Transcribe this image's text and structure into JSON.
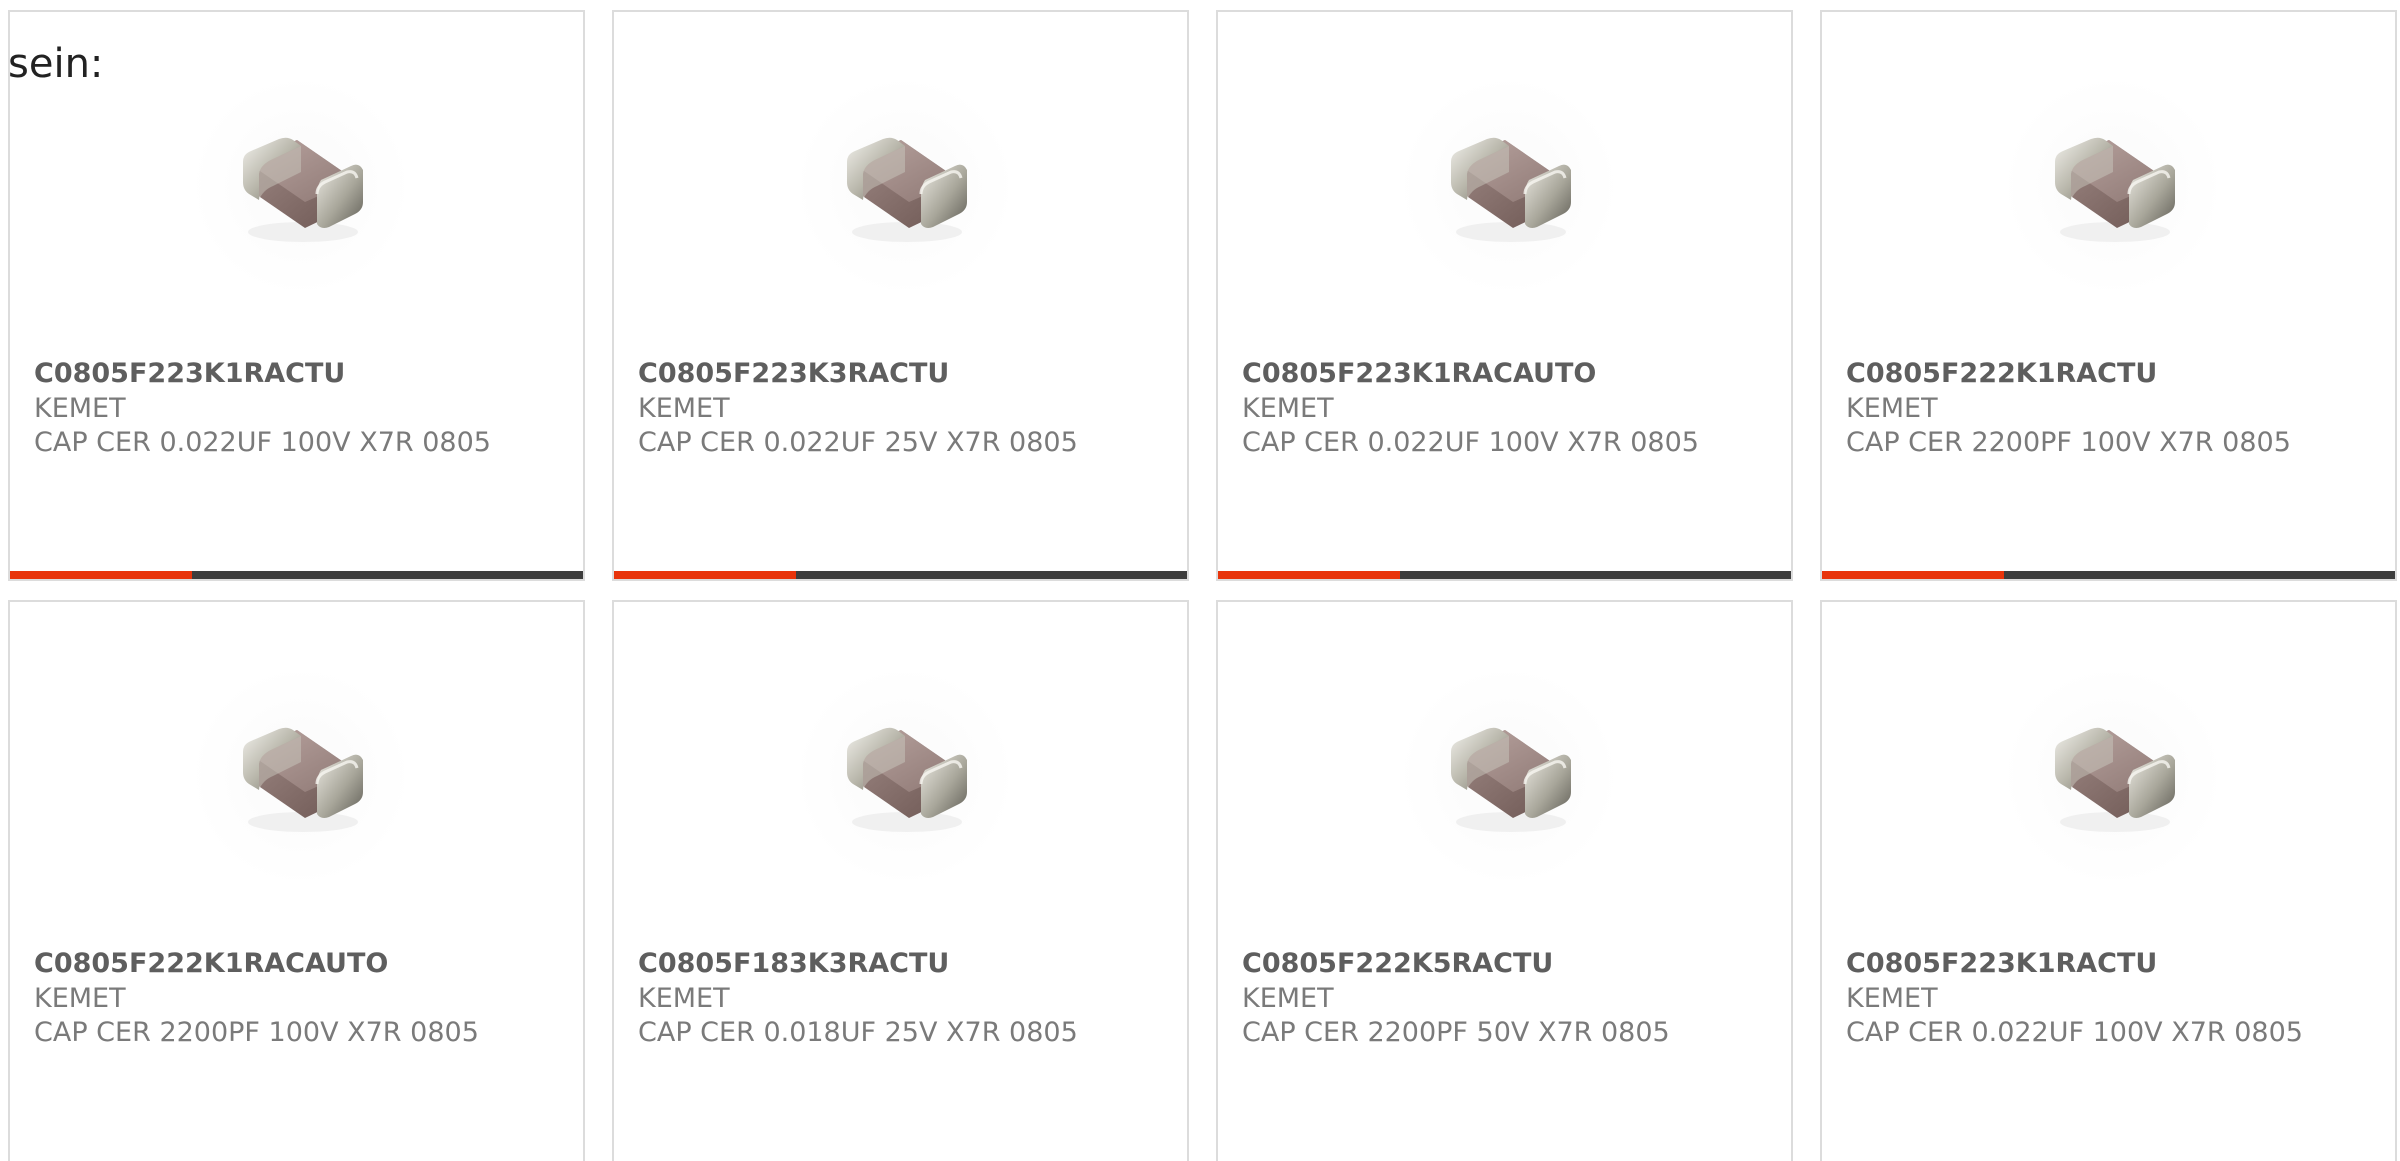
{
  "intro_text": "sein:",
  "colors": {
    "accent_bar": "#e8340b",
    "dark_bar": "#3d3d3d",
    "card_border": "#dcdcdc"
  },
  "products": [
    {
      "part_number": "C0805F223K1RACTU",
      "manufacturer": "KEMET",
      "description": "CAP CER 0.022UF 100V X7R 0805",
      "image_icon": "ceramic-capacitor-chip-icon"
    },
    {
      "part_number": "C0805F223K3RACTU",
      "manufacturer": "KEMET",
      "description": "CAP CER 0.022UF 25V X7R 0805",
      "image_icon": "ceramic-capacitor-chip-icon"
    },
    {
      "part_number": "C0805F223K1RACAUTO",
      "manufacturer": "KEMET",
      "description": "CAP CER 0.022UF 100V X7R 0805",
      "image_icon": "ceramic-capacitor-chip-icon"
    },
    {
      "part_number": "C0805F222K1RACTU",
      "manufacturer": "KEMET",
      "description": "CAP CER 2200PF 100V X7R 0805",
      "image_icon": "ceramic-capacitor-chip-icon"
    },
    {
      "part_number": "C0805F222K1RACAUTO",
      "manufacturer": "KEMET",
      "description": "CAP CER 2200PF 100V X7R 0805",
      "image_icon": "ceramic-capacitor-chip-icon"
    },
    {
      "part_number": "C0805F183K3RACTU",
      "manufacturer": "KEMET",
      "description": "CAP CER 0.018UF 25V X7R 0805",
      "image_icon": "ceramic-capacitor-chip-icon"
    },
    {
      "part_number": "C0805F222K5RACTU",
      "manufacturer": "KEMET",
      "description": "CAP CER 2200PF 50V X7R 0805",
      "image_icon": "ceramic-capacitor-chip-icon"
    },
    {
      "part_number": "C0805F223K1RACTU",
      "manufacturer": "KEMET",
      "description": "CAP CER 0.022UF 100V X7R 0805",
      "image_icon": "ceramic-capacitor-chip-icon"
    }
  ]
}
